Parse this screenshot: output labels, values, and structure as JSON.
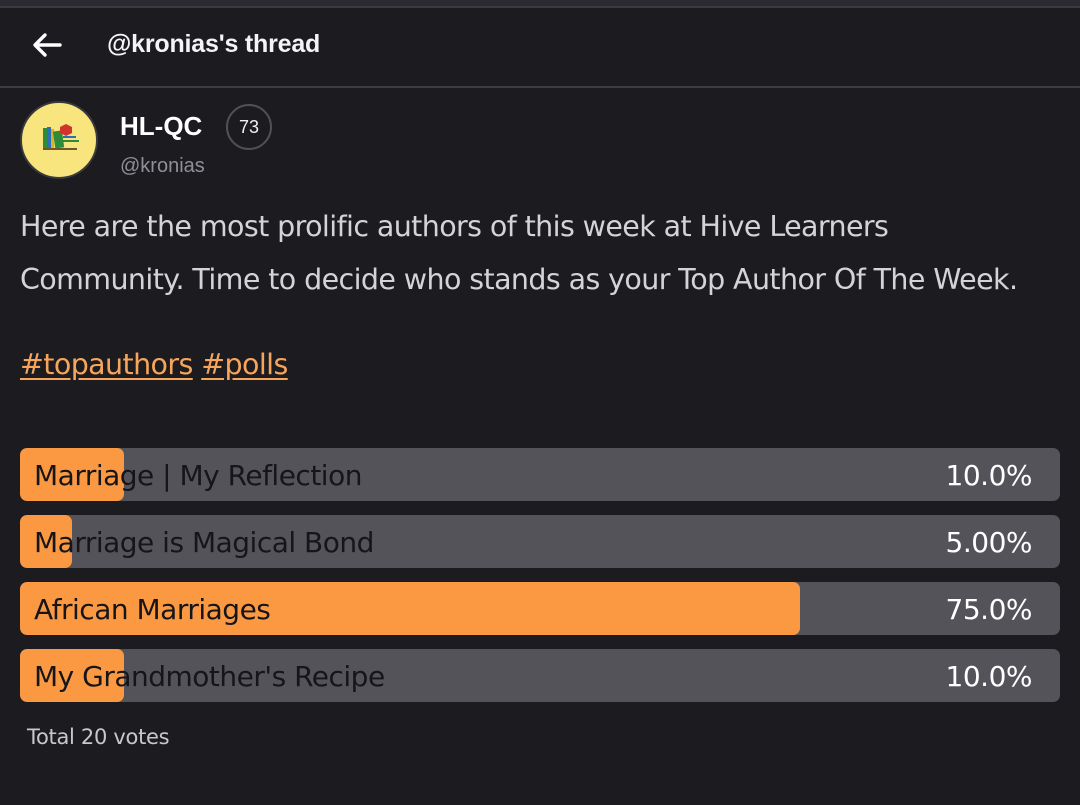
{
  "header": {
    "back_icon": "arrow-left-icon",
    "title": "@kronias's thread"
  },
  "post": {
    "author": {
      "name": "HL-QC",
      "reputation": "73",
      "handle": "@kronias",
      "avatar_icon": "hive-learners-logo"
    },
    "body_line1": "Here are the most prolific authors of this week at Hive Learners",
    "body_line2": "Community. Time to decide who stands as your Top Author Of The Week.",
    "tags": [
      "#topauthors",
      "#polls"
    ]
  },
  "poll": {
    "options": [
      {
        "label": "Marriage | My Reflection",
        "percent_text": "10.0%",
        "fraction": 0.1
      },
      {
        "label": "Marriage is Magical Bond",
        "percent_text": "5.00%",
        "fraction": 0.05
      },
      {
        "label": "African Marriages",
        "percent_text": "75.0%",
        "fraction": 0.75
      },
      {
        "label": "My Grandmother's Recipe",
        "percent_text": "10.0%",
        "fraction": 0.1
      }
    ],
    "total": "Total 20 votes"
  },
  "colors": {
    "background": "#1c1b20",
    "accent": "#fb9942",
    "bar_track": "#54535a",
    "tag": "#f6a55a"
  }
}
